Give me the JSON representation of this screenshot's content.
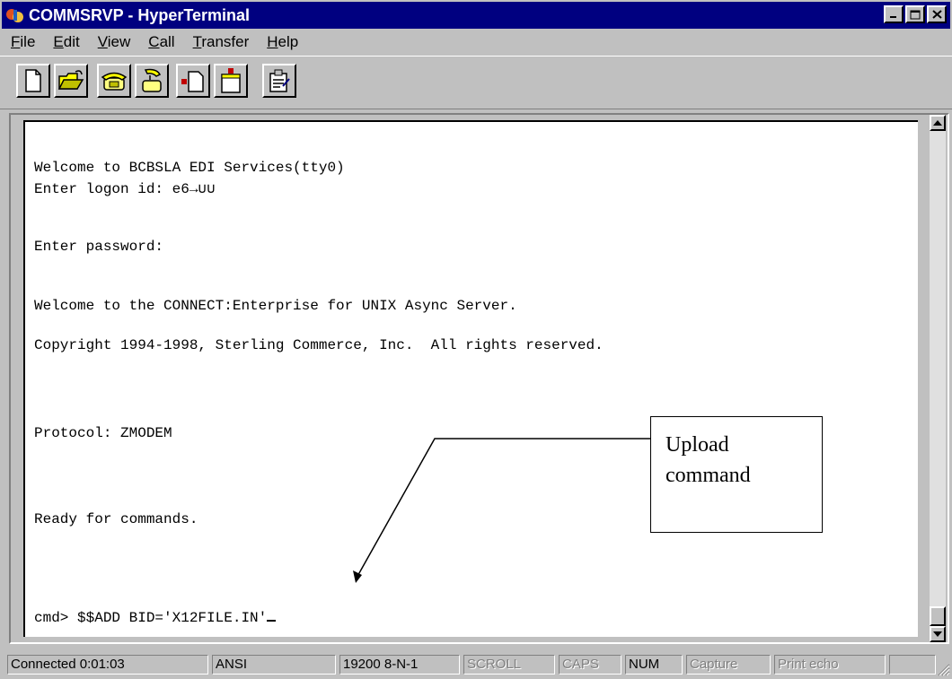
{
  "window": {
    "title": "COMMSRVP - HyperTerminal"
  },
  "menu": [
    {
      "label": "File",
      "ul": "F",
      "rest": "ile"
    },
    {
      "label": "Edit",
      "ul": "E",
      "rest": "dit"
    },
    {
      "label": "View",
      "ul": "V",
      "rest": "iew"
    },
    {
      "label": "Call",
      "ul": "C",
      "rest": "all"
    },
    {
      "label": "Transfer",
      "ul": "T",
      "rest": "ransfer"
    },
    {
      "label": "Help",
      "ul": "H",
      "rest": "elp"
    }
  ],
  "toolbar": [
    "new-icon",
    "open-folder-icon",
    "connect-phone-icon",
    "disconnect-phone-icon",
    "send-file-icon",
    "receive-file-icon",
    "properties-icon"
  ],
  "terminal": {
    "lines": [
      "Welcome to BCBSLA EDI Services(tty0)",
      "Enter logon id: e6→∪∪",
      "Enter password:",
      "Welcome to the CONNECT:Enterprise for UNIX Async Server.",
      "Copyright 1994-1998, Sterling Commerce, Inc.  All rights reserved.",
      "Protocol: ZMODEM",
      "Ready for commands.",
      "cmd> $$ADD BID='X12FILE.IN'"
    ]
  },
  "annotation": {
    "line1": "Upload",
    "line2": "command"
  },
  "status": {
    "connected": "Connected 0:01:03",
    "emulation": "ANSI",
    "settings": "19200 8-N-1",
    "scroll": "SCROLL",
    "caps": "CAPS",
    "num": "NUM",
    "capture": "Capture",
    "print_echo": "Print echo"
  },
  "colors": {
    "titlebar": "#000080",
    "face": "#c0c0c0",
    "terminal_bg": "#ffffff"
  }
}
